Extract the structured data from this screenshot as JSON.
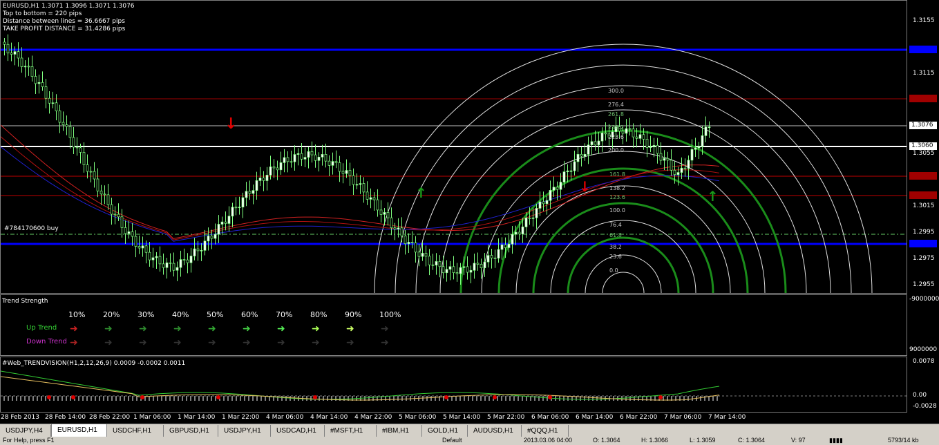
{
  "chart": {
    "symbol_header": "EURUSD,H1  1.3071 1.3096 1.3071 1.3076",
    "info_lines": [
      "Top to bottom = 220 pips",
      "Distance between lines = 36.6667 pips",
      "TAKE PROFIT DISTANCE = 31.4286 pips"
    ],
    "order_label": "#784170600 buy",
    "price_scale": [
      "1.3155",
      "1.3115",
      "1.3055",
      "1.3015",
      "1.2995",
      "1.2975",
      "1.2955"
    ],
    "current_price": "1.3076",
    "level_1_3060": "1.3060",
    "fib_labels": [
      "300.0",
      "276.4",
      "261.8",
      "238.2",
      "223.6",
      "200.0",
      "161.8",
      "138.2",
      "123.6",
      "100.0",
      "76.4",
      "61.8",
      "38.2",
      "23.6",
      "0.0"
    ]
  },
  "trend_strength": {
    "title": "Trend Strength",
    "percent_headers": [
      "10%",
      "20%",
      "30%",
      "40%",
      "50%",
      "60%",
      "70%",
      "80%",
      "90%",
      "100%"
    ],
    "up_label": "Up Trend",
    "down_label": "Down Trend",
    "scale_top": "-9000000",
    "scale_bottom": "9000000",
    "colors": {
      "up": "#33cc33",
      "down": "#cc33cc"
    }
  },
  "oscillator": {
    "title": "#Web_TRENDVISION(H1,2,12,26,9) 0.0009 -0.0002 0.0011",
    "scale": [
      "0.0078",
      "0.00",
      "-0.0028"
    ]
  },
  "x_axis": [
    "28 Feb 2013",
    "28 Feb 14:00",
    "28 Feb 22:00",
    "1 Mar 06:00",
    "1 Mar 14:00",
    "1 Mar 22:00",
    "4 Mar 06:00",
    "4 Mar 14:00",
    "4 Mar 22:00",
    "5 Mar 06:00",
    "5 Mar 14:00",
    "5 Mar 22:00",
    "6 Mar 06:00",
    "6 Mar 14:00",
    "6 Mar 22:00",
    "7 Mar 06:00",
    "7 Mar 14:00"
  ],
  "tabs": [
    "USDJPY,H4",
    "EURUSD,H1",
    "USDCHF,H1",
    "GBPUSD,H1",
    "USDJPY,H1",
    "USDCAD,H1",
    "#MSFT,H1",
    "#IBM,H1",
    "GOLD,H1",
    "AUDUSD,H1",
    "#QQQ,H1"
  ],
  "active_tab": "EURUSD,H1",
  "status": [
    "For Help, press F1",
    "Default",
    "2013.03.06 04:00",
    "O: 1.3064",
    "H: 1.3066",
    "L: 1.3059",
    "C: 1.3064",
    "V: 97",
    "5793/14 kb"
  ]
}
